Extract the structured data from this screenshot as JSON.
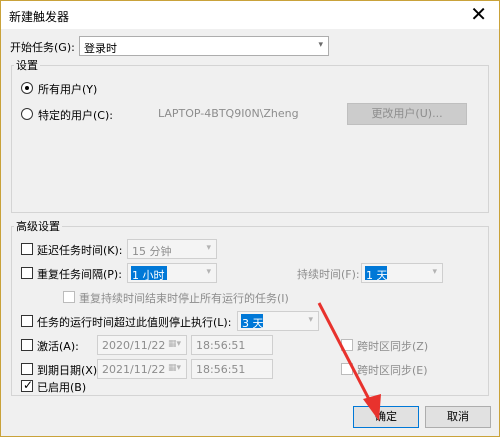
{
  "window": {
    "title": "新建触发器",
    "close_glyph": "✕"
  },
  "start_task": {
    "label": "开始任务(G):",
    "value": "登录时"
  },
  "settings": {
    "legend": "设置",
    "any_user": "所有用户(Y)",
    "specific_user": "特定的用户(C):",
    "user_name": "LAPTOP-4BTQ9I0N\\Zheng",
    "change_user": "更改用户(U)..."
  },
  "advanced": {
    "legend": "高级设置",
    "delay": {
      "label": "延迟任务时间(K):",
      "value": "15 分钟",
      "checked": false
    },
    "repeat": {
      "label": "重复任务间隔(P):",
      "value": "1 小时",
      "checked": false,
      "duration_label": "持续时间(F):",
      "duration_value": "1 天"
    },
    "stop_all": {
      "label": "重复持续时间结束时停止所有运行的任务(I)",
      "checked": false
    },
    "stop_longer": {
      "label": "任务的运行时间超过此值则停止执行(L):",
      "value": "3 天",
      "checked": false
    },
    "activate": {
      "label": "激活(A):",
      "date": "2020/11/22",
      "time": "18:56:51",
      "sync_label": "跨时区同步(Z)",
      "checked": false
    },
    "expire": {
      "label": "到期日期(X):",
      "date": "2021/11/22",
      "time": "18:56:51",
      "sync_label": "跨时区同步(E)",
      "checked": false
    },
    "enabled": {
      "label": "已启用(B)",
      "checked": true
    }
  },
  "buttons": {
    "ok": "确定",
    "cancel": "取消"
  },
  "icons": {
    "dropdown": "▾",
    "calendar": "▦▾",
    "checkmark": "✓"
  },
  "colors": {
    "accent": "#0078d7",
    "annotation_arrow": "#e8322d"
  }
}
